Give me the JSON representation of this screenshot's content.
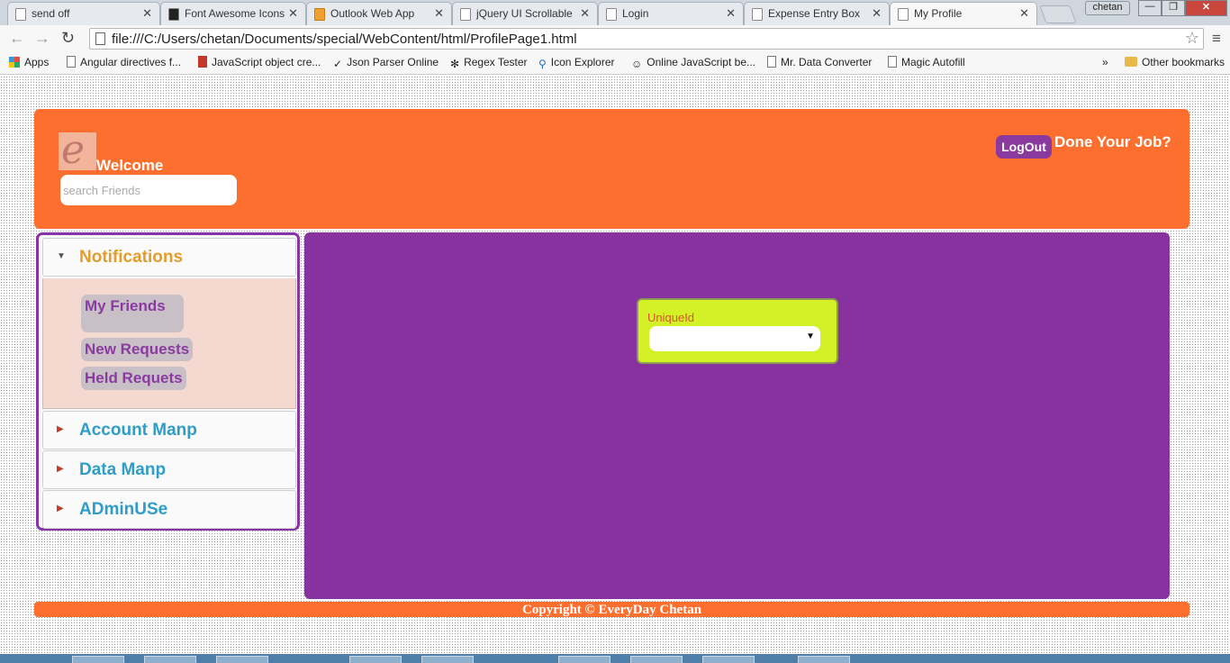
{
  "browser": {
    "tabs": [
      {
        "title": "send off",
        "active": false
      },
      {
        "title": "Font Awesome Icons",
        "active": false
      },
      {
        "title": "Outlook Web App",
        "active": false
      },
      {
        "title": "jQuery UI Scrollable",
        "active": false
      },
      {
        "title": "Login",
        "active": false
      },
      {
        "title": "Expense Entry Box",
        "active": false
      },
      {
        "title": "My Profile",
        "active": true
      }
    ],
    "user": "chetan",
    "url": "file:///C:/Users/chetan/Documents/special/WebContent/html/ProfilePage1.html",
    "bookmarks": [
      "Apps",
      "Angular directives f...",
      "JavaScript object cre...",
      "Json Parser Online",
      "Regex Tester",
      "Icon Explorer",
      "Online JavaScript be...",
      "Mr. Data Converter",
      "Magic Autofill"
    ],
    "bookmarks_overflow": "»",
    "other_bookmarks": "Other bookmarks"
  },
  "header": {
    "welcome": "Welcome",
    "search_placeholder": "search Friends",
    "logout_label": "LogOut",
    "tagline": "Done Your Job?"
  },
  "sidebar": {
    "sections": [
      "Notifications",
      "Account Manp",
      "Data Manp",
      "ADminUSe"
    ],
    "notifications_items": [
      "My Friends",
      "New Requests",
      "Held Requets"
    ]
  },
  "main": {
    "unique_id_label": "UniqueId",
    "unique_id_value": ""
  },
  "footer": {
    "copyright": "Copyright © EveryDay Chetan"
  },
  "colors": {
    "header": "#fd6f2e",
    "sidebar_border": "#8634a6",
    "main_panel": "#8832a0",
    "uid_box": "#d3f126",
    "accordion_label": "#2e9ec9",
    "active_label": "#e49c2b"
  }
}
